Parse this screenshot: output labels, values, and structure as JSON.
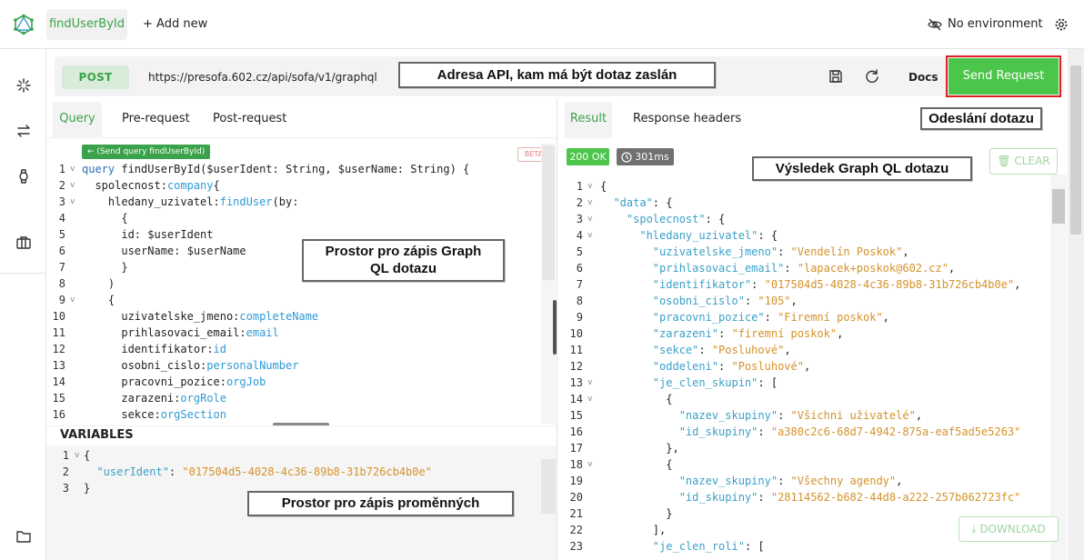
{
  "topbar": {
    "active_tab": "findUserById",
    "add_new": "+ Add new",
    "environment": "No environment"
  },
  "request": {
    "method": "POST",
    "url": "https://presofa.602.cz/api/sofa/v1/graphql",
    "docs": "Docs",
    "send": "Send Request"
  },
  "left_tabs": [
    "Query",
    "Pre-request",
    "Post-request"
  ],
  "right_tabs": [
    "Result",
    "Response headers"
  ],
  "query_editor": {
    "send_hint": "← (Send query findUserById)",
    "beta": "BETA",
    "line_numbers": [
      "1",
      "2",
      "3",
      "4",
      "5",
      "6",
      "7",
      "8",
      "9",
      "10",
      "11",
      "12",
      "13",
      "14",
      "15",
      "16"
    ],
    "lines": [
      [
        [
          "kw",
          "query "
        ],
        [
          "fn",
          "findUserById"
        ],
        [
          "punc",
          "($userIdent: String, $userName: String) {"
        ]
      ],
      [
        [
          "field",
          "  spolecnost"
        ],
        [
          "punc",
          ":"
        ],
        [
          "alias",
          "company"
        ],
        [
          "punc",
          "{"
        ]
      ],
      [
        [
          "field",
          "    hledany_uzivatel"
        ],
        [
          "punc",
          ":"
        ],
        [
          "alias",
          "findUser"
        ],
        [
          "punc",
          "("
        ],
        [
          "field",
          "by"
        ],
        [
          "punc",
          ":"
        ]
      ],
      [
        [
          "punc",
          "      {"
        ]
      ],
      [
        [
          "field",
          "      id"
        ],
        [
          "punc",
          ": "
        ],
        [
          "var",
          "$userIdent"
        ]
      ],
      [
        [
          "field",
          "      userName"
        ],
        [
          "punc",
          ": "
        ],
        [
          "var",
          "$userName"
        ]
      ],
      [
        [
          "punc",
          "      }"
        ]
      ],
      [
        [
          "punc",
          "    )"
        ]
      ],
      [
        [
          "punc",
          "    {"
        ]
      ],
      [
        [
          "field",
          "      uzivatelske_jmeno"
        ],
        [
          "punc",
          ":"
        ],
        [
          "alias",
          "completeName"
        ]
      ],
      [
        [
          "field",
          "      prihlasovaci_email"
        ],
        [
          "punc",
          ":"
        ],
        [
          "alias",
          "email"
        ]
      ],
      [
        [
          "field",
          "      identifikator"
        ],
        [
          "punc",
          ":"
        ],
        [
          "alias",
          "id"
        ]
      ],
      [
        [
          "field",
          "      osobni_cislo"
        ],
        [
          "punc",
          ":"
        ],
        [
          "alias",
          "personalNumber"
        ]
      ],
      [
        [
          "field",
          "      pracovni_pozice"
        ],
        [
          "punc",
          ":"
        ],
        [
          "alias",
          "orgJob"
        ]
      ],
      [
        [
          "field",
          "      zarazeni"
        ],
        [
          "punc",
          ":"
        ],
        [
          "alias",
          "orgRole"
        ]
      ],
      [
        [
          "field",
          "      sekce"
        ],
        [
          "punc",
          ":"
        ],
        [
          "alias",
          "orgSection"
        ]
      ]
    ]
  },
  "variables": {
    "label": "VARIABLES",
    "line_numbers": [
      "1",
      "2",
      "3"
    ],
    "lines": [
      [
        [
          "punc",
          "{"
        ]
      ],
      [
        [
          "key",
          "  \"userIdent\""
        ],
        [
          "punc",
          ": "
        ],
        [
          "str",
          "\"017504d5-4028-4c36-89b8-31b726cb4b0e\""
        ]
      ],
      [
        [
          "punc",
          "}"
        ]
      ]
    ]
  },
  "result": {
    "status": "200 OK",
    "time": "301ms",
    "clear": "CLEAR",
    "download": "DOWNLOAD",
    "line_numbers": [
      "1",
      "2",
      "3",
      "4",
      "5",
      "6",
      "7",
      "8",
      "9",
      "10",
      "11",
      "12",
      "13",
      "14",
      "15",
      "16",
      "17",
      "18",
      "19",
      "20",
      "21",
      "22",
      "23"
    ],
    "lines": [
      [
        [
          "punc",
          "{"
        ]
      ],
      [
        [
          "key",
          "  \"data\""
        ],
        [
          "punc",
          ": {"
        ]
      ],
      [
        [
          "key",
          "    \"spolecnost\""
        ],
        [
          "punc",
          ": {"
        ]
      ],
      [
        [
          "key",
          "      \"hledany_uzivatel\""
        ],
        [
          "punc",
          ": {"
        ]
      ],
      [
        [
          "key",
          "        \"uzivatelske_jmeno\""
        ],
        [
          "punc",
          ": "
        ],
        [
          "str",
          "\"Vendelín Poskok\""
        ],
        [
          "punc",
          ","
        ]
      ],
      [
        [
          "key",
          "        \"prihlasovaci_email\""
        ],
        [
          "punc",
          ": "
        ],
        [
          "str",
          "\"lapacek+poskok@602.cz\""
        ],
        [
          "punc",
          ","
        ]
      ],
      [
        [
          "key",
          "        \"identifikator\""
        ],
        [
          "punc",
          ": "
        ],
        [
          "str",
          "\"017504d5-4028-4c36-89b8-31b726cb4b0e\""
        ],
        [
          "punc",
          ","
        ]
      ],
      [
        [
          "key",
          "        \"osobni_cislo\""
        ],
        [
          "punc",
          ": "
        ],
        [
          "str",
          "\"105\""
        ],
        [
          "punc",
          ","
        ]
      ],
      [
        [
          "key",
          "        \"pracovni_pozice\""
        ],
        [
          "punc",
          ": "
        ],
        [
          "str",
          "\"Firemní poskok\""
        ],
        [
          "punc",
          ","
        ]
      ],
      [
        [
          "key",
          "        \"zarazeni\""
        ],
        [
          "punc",
          ": "
        ],
        [
          "str",
          "\"firemní poskok\""
        ],
        [
          "punc",
          ","
        ]
      ],
      [
        [
          "key",
          "        \"sekce\""
        ],
        [
          "punc",
          ": "
        ],
        [
          "str",
          "\"Posluhové\""
        ],
        [
          "punc",
          ","
        ]
      ],
      [
        [
          "key",
          "        \"oddeleni\""
        ],
        [
          "punc",
          ": "
        ],
        [
          "str",
          "\"Posluhové\""
        ],
        [
          "punc",
          ","
        ]
      ],
      [
        [
          "key",
          "        \"je_clen_skupin\""
        ],
        [
          "punc",
          ": ["
        ]
      ],
      [
        [
          "punc",
          "          {"
        ]
      ],
      [
        [
          "key",
          "            \"nazev_skupiny\""
        ],
        [
          "punc",
          ": "
        ],
        [
          "str",
          "\"Všichni uživatelé\""
        ],
        [
          "punc",
          ","
        ]
      ],
      [
        [
          "key",
          "            \"id_skupiny\""
        ],
        [
          "punc",
          ": "
        ],
        [
          "str",
          "\"a380c2c6-68d7-4942-875a-eaf5ad5e5263\""
        ]
      ],
      [
        [
          "punc",
          "          },"
        ]
      ],
      [
        [
          "punc",
          "          {"
        ]
      ],
      [
        [
          "key",
          "            \"nazev_skupiny\""
        ],
        [
          "punc",
          ": "
        ],
        [
          "str",
          "\"Všechny agendy\""
        ],
        [
          "punc",
          ","
        ]
      ],
      [
        [
          "key",
          "            \"id_skupiny\""
        ],
        [
          "punc",
          ": "
        ],
        [
          "str",
          "\"28114562-b682-44d8-a222-257b062723fc\""
        ]
      ],
      [
        [
          "punc",
          "          }"
        ]
      ],
      [
        [
          "punc",
          "        ],"
        ]
      ],
      [
        [
          "key",
          "        \"je_clen_roli\""
        ],
        [
          "punc",
          ": ["
        ]
      ]
    ]
  },
  "annotations": {
    "api_address": "Adresa API, kam má být dotaz zaslán",
    "send_query": "Odeslání dotazu",
    "query_space_line1": "Prostor pro zápis Graph",
    "query_space_line2": "QL dotazu",
    "variables_space": "Prostor pro zápis proměnných",
    "result_note": "Výsledek Graph QL dotazu"
  },
  "colors": {
    "accent": "#3aa24a",
    "send_button": "#4bc54a",
    "send_outline": "#e02020",
    "string": "#d4922a",
    "key": "#3aa0c8"
  }
}
